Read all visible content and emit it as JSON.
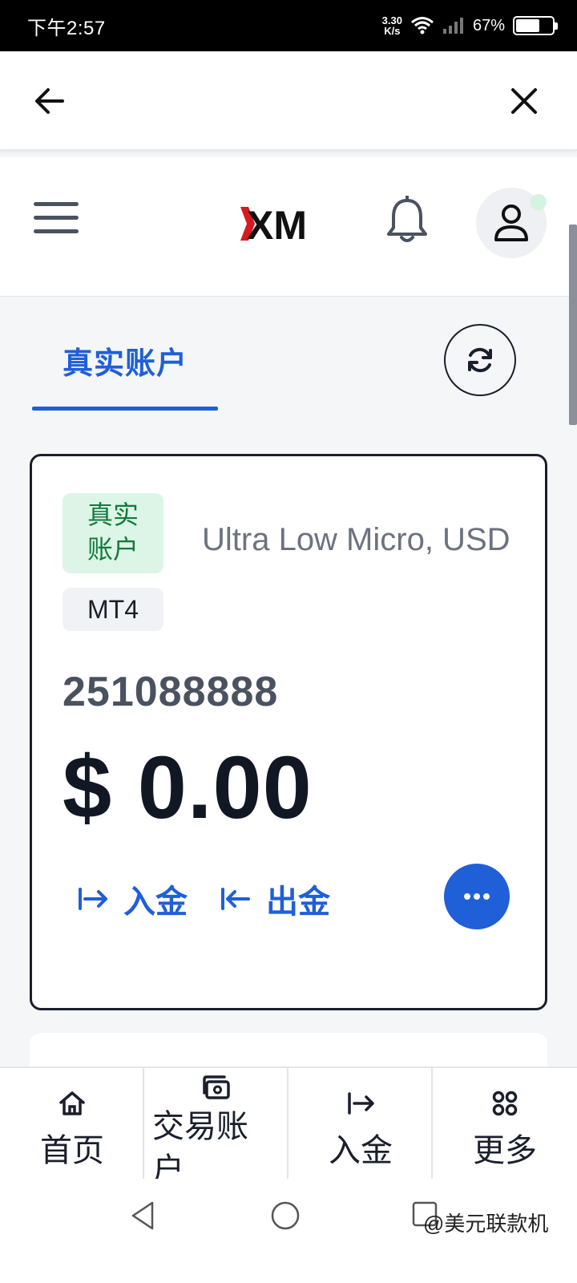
{
  "status_bar": {
    "time": "下午2:57",
    "net_speed_value": "3.30",
    "net_speed_unit": "K/s",
    "battery_percent": "67%",
    "battery_level": 0.67
  },
  "top_nav": {
    "back_icon": "arrow-left-icon",
    "close_icon": "close-icon"
  },
  "header": {
    "menu_icon": "hamburger-menu-icon",
    "logo": "XM",
    "bell_icon": "bell-icon",
    "avatar_icon": "user-icon"
  },
  "tabs": {
    "active_label": "真实账户",
    "refresh_icon": "refresh-icon"
  },
  "account": {
    "type_badge_line1": "真实",
    "type_badge_line2": "账户",
    "platform": "MT4",
    "plan": "Ultra Low Micro, USD",
    "number": "251088888",
    "balance": "$ 0.00",
    "deposit_label": "入金",
    "withdraw_label": "出金"
  },
  "bottom_nav": {
    "items": [
      {
        "label": "首页",
        "icon": "home-icon"
      },
      {
        "label": "交易账户",
        "icon": "wallet-icon"
      },
      {
        "label": "入金",
        "icon": "deposit-icon"
      },
      {
        "label": "更多",
        "icon": "grid-icon"
      }
    ]
  },
  "system_nav": {
    "watermark": "@美元联款机"
  },
  "colors": {
    "accent": "#1f5fd8",
    "badge_green_bg": "#dcf5e6",
    "badge_green_text": "#127a3c",
    "brand_red": "#d71920"
  }
}
